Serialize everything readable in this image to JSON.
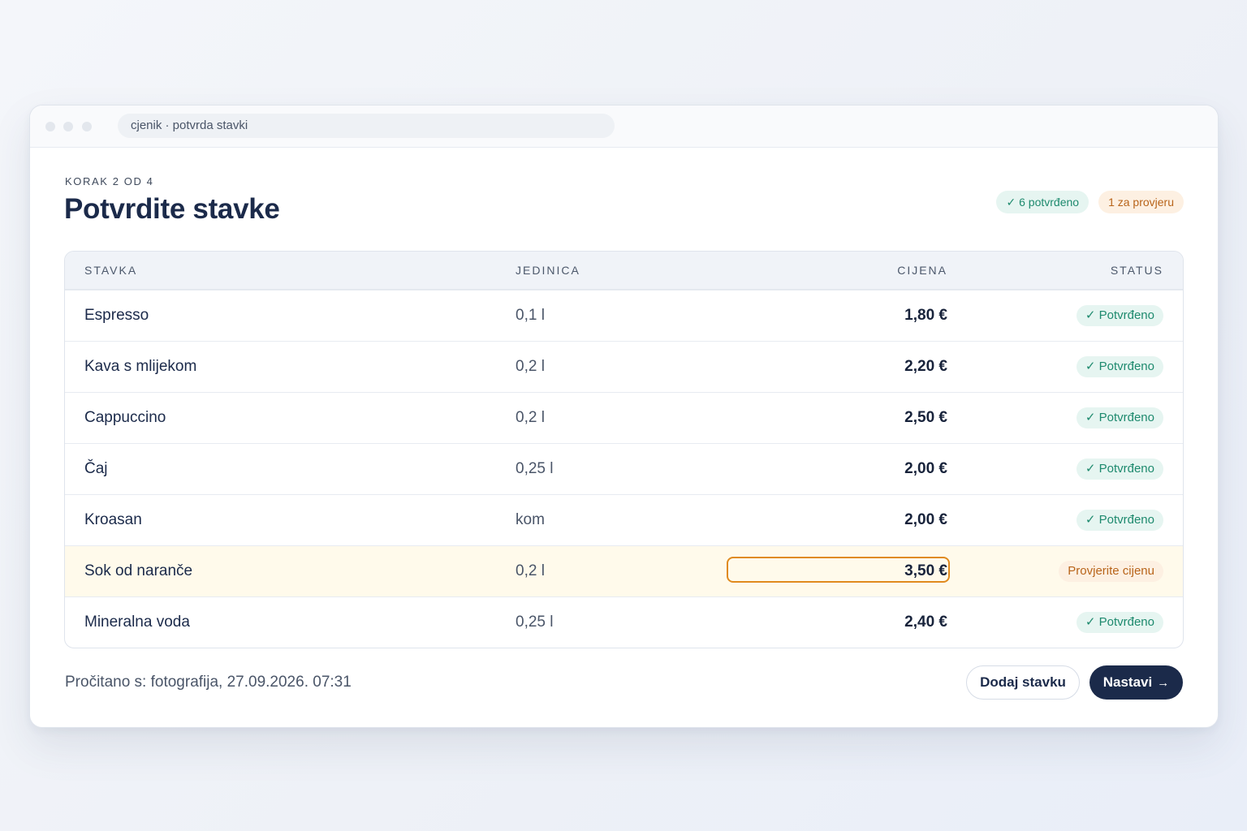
{
  "window": {
    "address": "cjenik · potvrda stavki"
  },
  "header": {
    "step": "KORAK 2 OD 4",
    "title": "Potvrdite stavke",
    "confirmed_summary": "✓ 6 potvrđeno",
    "review_summary": "1 za provjeru"
  },
  "table": {
    "columns": {
      "item": "STAVKA",
      "unit": "JEDINICA",
      "price": "CIJENA",
      "status": "STATUS"
    },
    "rows": [
      {
        "name": "Espresso",
        "unit": "0,1 l",
        "price": "1,80 €",
        "status": "✓ Potvrđeno",
        "state": "confirmed"
      },
      {
        "name": "Kava s mlijekom",
        "unit": "0,2 l",
        "price": "2,20 €",
        "status": "✓ Potvrđeno",
        "state": "confirmed"
      },
      {
        "name": "Cappuccino",
        "unit": "0,2 l",
        "price": "2,50 €",
        "status": "✓ Potvrđeno",
        "state": "confirmed"
      },
      {
        "name": "Čaj",
        "unit": "0,25 l",
        "price": "2,00 €",
        "status": "✓ Potvrđeno",
        "state": "confirmed"
      },
      {
        "name": "Kroasan",
        "unit": "kom",
        "price": "2,00 €",
        "status": "✓ Potvrđeno",
        "state": "confirmed"
      },
      {
        "name": "Sok od naranče",
        "unit": "0,2 l",
        "price": "3,50 €",
        "status": "Provjerite cijenu",
        "state": "review"
      },
      {
        "name": "Mineralna voda",
        "unit": "0,25 l",
        "price": "2,40 €",
        "status": "✓ Potvrđeno",
        "state": "confirmed"
      }
    ]
  },
  "footer": {
    "source": "Pročitano s: fotografija, 27.09.2026. 07:31",
    "add_label": "Dodaj stavku",
    "next_label": "Nastavi",
    "next_arrow": "→"
  },
  "colors": {
    "primary": "#1b2a4a",
    "confirmed": "#1e8a6e",
    "review": "#e08a1e",
    "review_row_bg": "#fffaeb"
  }
}
